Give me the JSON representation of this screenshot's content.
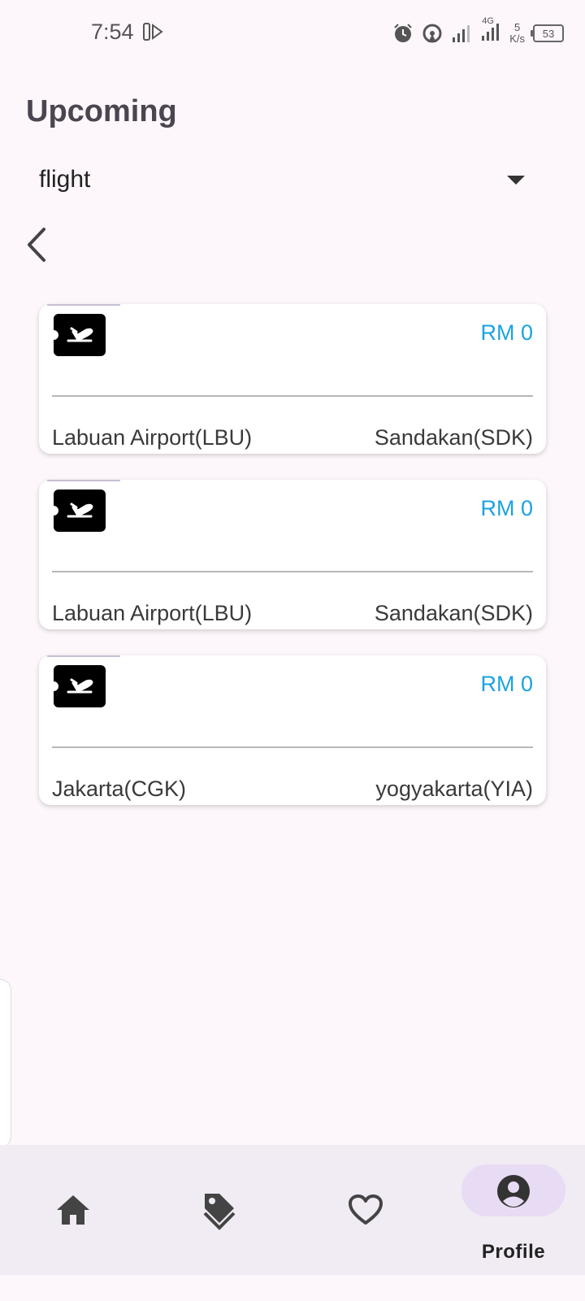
{
  "status_bar": {
    "time": "7:54",
    "network": "4G",
    "net_speed_value": "5",
    "net_speed_unit": "K/s",
    "battery": "53"
  },
  "header": {
    "title": "Upcoming"
  },
  "filter": {
    "selected": "flight"
  },
  "bookings": [
    {
      "price": "RM 0",
      "from": "Labuan Airport(LBU)",
      "to": "Sandakan(SDK)"
    },
    {
      "price": "RM 0",
      "from": "Labuan Airport(LBU)",
      "to": "Sandakan(SDK)"
    },
    {
      "price": "RM 0",
      "from": "Jakarta(CGK)",
      "to": "yogyakarta(YIA)"
    }
  ],
  "bottom_nav": {
    "items": [
      {
        "icon": "home-icon"
      },
      {
        "icon": "tag-icon"
      },
      {
        "icon": "heart-icon"
      },
      {
        "icon": "profile-icon",
        "label": "Profile"
      }
    ]
  }
}
